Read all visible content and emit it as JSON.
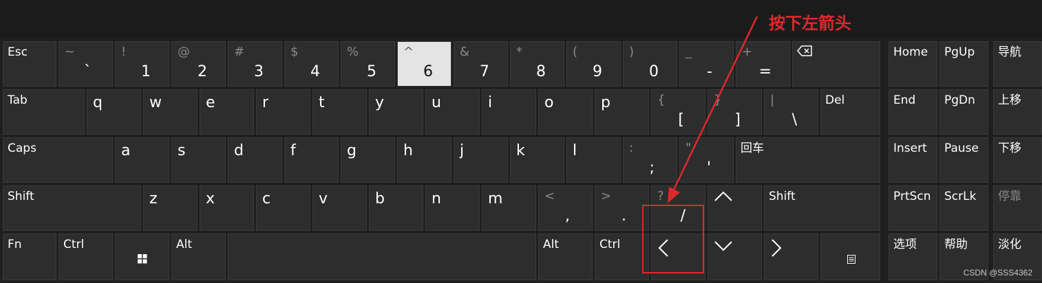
{
  "annotation": "按下左箭头",
  "watermark": "CSDN @SSS4362",
  "row1": {
    "esc": "Esc",
    "grave": {
      "shift": "~",
      "main": "`"
    },
    "k1": {
      "shift": "!",
      "main": "1"
    },
    "k2": {
      "shift": "@",
      "main": "2"
    },
    "k3": {
      "shift": "#",
      "main": "3"
    },
    "k4": {
      "shift": "$",
      "main": "4"
    },
    "k5": {
      "shift": "%",
      "main": "5"
    },
    "k6": {
      "shift": "^",
      "main": "6"
    },
    "k7": {
      "shift": "&",
      "main": "7"
    },
    "k8": {
      "shift": "*",
      "main": "8"
    },
    "k9": {
      "shift": "(",
      "main": "9"
    },
    "k0": {
      "shift": ")",
      "main": "0"
    },
    "minus": {
      "shift": "_",
      "main": "-"
    },
    "equal": {
      "shift": "+",
      "main": "="
    }
  },
  "row2": {
    "tab": "Tab",
    "letters": [
      "q",
      "w",
      "e",
      "r",
      "t",
      "y",
      "u",
      "i",
      "o",
      "p"
    ],
    "lbracket": {
      "shift": "{",
      "main": "["
    },
    "rbracket": {
      "shift": "}",
      "main": "]"
    },
    "backslash": {
      "shift": "|",
      "main": "\\"
    },
    "del": "Del"
  },
  "row3": {
    "caps": "Caps",
    "letters": [
      "a",
      "s",
      "d",
      "f",
      "g",
      "h",
      "j",
      "k",
      "l"
    ],
    "semicolon": {
      "shift": ":",
      "main": ";"
    },
    "quote": {
      "shift": "\"",
      "main": "'"
    },
    "enter": "回车"
  },
  "row4": {
    "lshift": "Shift",
    "letters": [
      "z",
      "x",
      "c",
      "v",
      "b",
      "n",
      "m"
    ],
    "comma": {
      "shift": "<",
      "main": ","
    },
    "period": {
      "shift": ">",
      "main": "."
    },
    "slash": {
      "shift": "?",
      "main": "/"
    },
    "rshift": "Shift"
  },
  "row5": {
    "fn": "Fn",
    "lctrl": "Ctrl",
    "lalt": "Alt",
    "ralt": "Alt",
    "rctrl": "Ctrl"
  },
  "nav": {
    "home": "Home",
    "pgup": "PgUp",
    "nav": "导航",
    "end": "End",
    "pgdn": "PgDn",
    "moveup": "上移",
    "insert": "Insert",
    "pause": "Pause",
    "movedown": "下移",
    "prtscn": "PrtScn",
    "scrlk": "ScrLk",
    "dock": "停靠",
    "options": "选项",
    "help": "帮助",
    "fade": "淡化"
  },
  "icons": {
    "backspace": "backspace-icon",
    "windows": "windows-icon",
    "menu": "menu-icon",
    "up": "arrow-up-icon",
    "down": "arrow-down-icon",
    "left": "arrow-left-icon",
    "right": "arrow-right-icon"
  },
  "colors": {
    "accent": "#e0282c",
    "key": "#2d2d2d",
    "pressed": "#e4e4e4"
  }
}
